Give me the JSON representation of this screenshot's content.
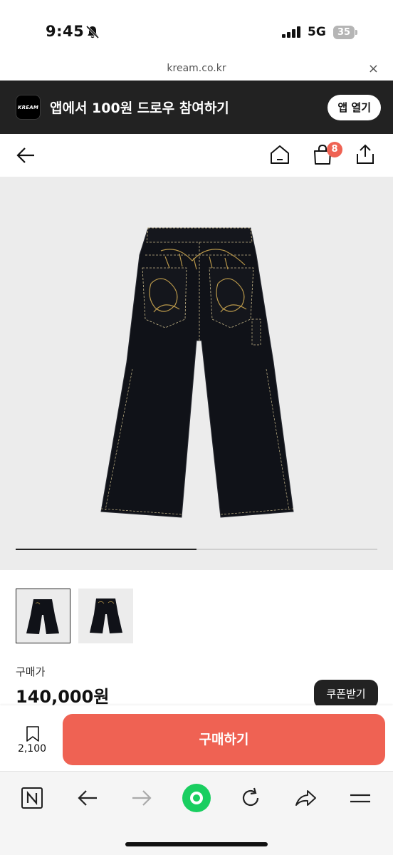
{
  "status_bar": {
    "time": "9:45",
    "network": "5G",
    "battery": "35"
  },
  "browser": {
    "url": "kream.co.kr",
    "close": "×"
  },
  "app_banner": {
    "logo_text": "KREAM",
    "message": "앱에서 100원 드로우 참여하기",
    "open_button": "앱 열기"
  },
  "header": {
    "cart_count": "8"
  },
  "gallery": {
    "image_count": 2,
    "current_index": 1
  },
  "product": {
    "price_label": "구매가",
    "price": "140,000원",
    "coupon_button": "쿠폰받기"
  },
  "purchase_bar": {
    "wish_count": "2,100",
    "buy_button": "구매하기"
  },
  "colors": {
    "brand_red": "#ef6253",
    "banner_bg": "#222222",
    "image_bg": "#ececec"
  },
  "icons": [
    "bell-off-icon",
    "signal-icon",
    "battery-icon",
    "back-arrow-icon",
    "home-icon",
    "shopping-bag-icon",
    "share-icon",
    "bookmark-icon",
    "naver-n-icon",
    "browser-back-icon",
    "browser-forward-icon",
    "green-dot-icon",
    "refresh-icon",
    "browser-share-icon",
    "menu-icon"
  ]
}
